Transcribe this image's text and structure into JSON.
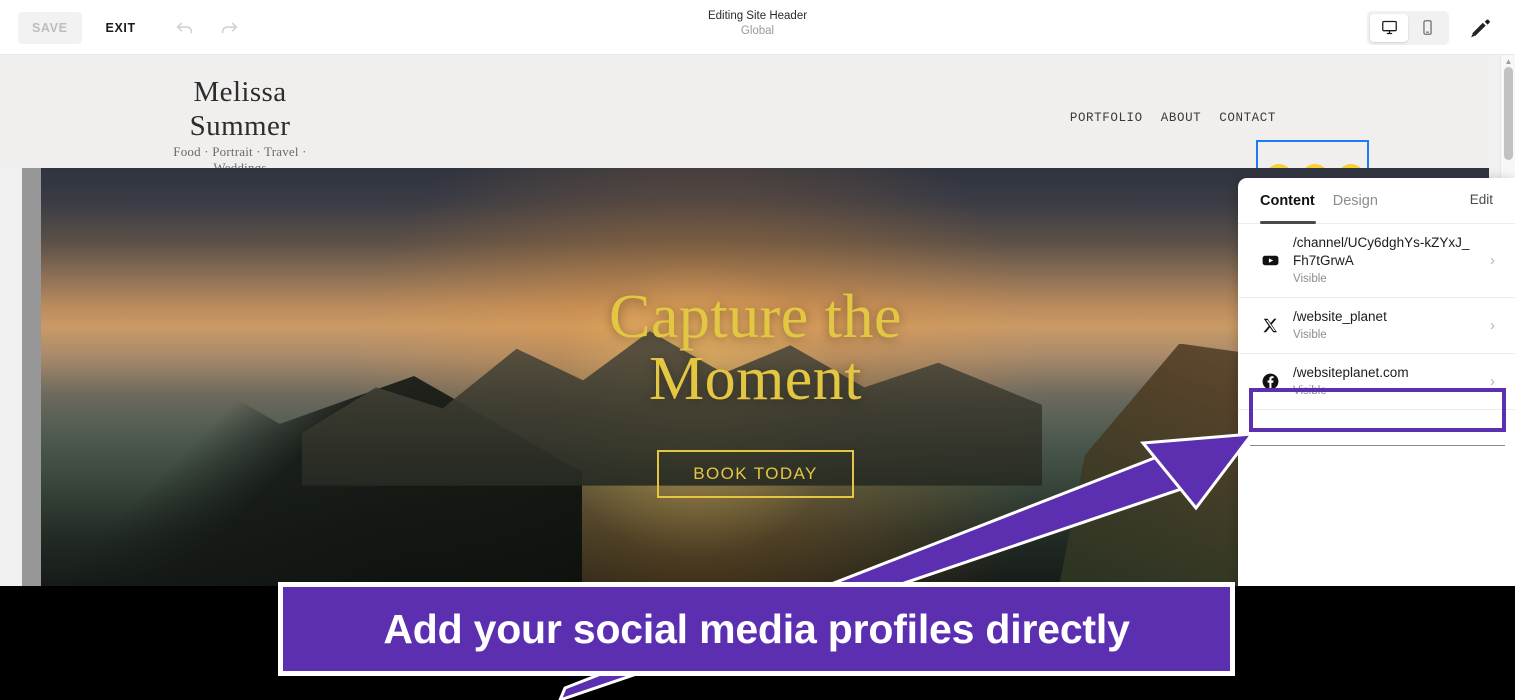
{
  "toolbar": {
    "save_label": "SAVE",
    "exit_label": "EXIT",
    "undo_icon": "undo-arrow-icon",
    "redo_icon": "redo-arrow-icon",
    "title": "Editing Site Header",
    "subtitle": "Global",
    "desktop_icon": "desktop-monitor-icon",
    "mobile_icon": "mobile-phone-icon",
    "brush_icon": "paintbrush-icon",
    "active_device": "desktop"
  },
  "site": {
    "logo_name": "Melissa Summer",
    "logo_tagline": "Food · Portrait · Travel · Weddings",
    "nav": [
      {
        "label": "PORTFOLIO"
      },
      {
        "label": "ABOUT"
      },
      {
        "label": "CONTACT"
      }
    ],
    "social_icons": [
      {
        "name": "youtube-icon",
        "glyph": "youtube"
      },
      {
        "name": "x-twitter-icon",
        "glyph": "x"
      },
      {
        "name": "facebook-icon",
        "glyph": "facebook"
      }
    ],
    "social_chip_color": "#f9cf33",
    "selection_color": "#1f7bf4",
    "hero_line1": "Capture the",
    "hero_line2": "Moment",
    "hero_button": "BOOK TODAY",
    "hero_accent_color": "#e3c742"
  },
  "panel": {
    "tabs": [
      {
        "label": "Content",
        "active": true
      },
      {
        "label": "Design",
        "active": false
      }
    ],
    "edit_label": "Edit",
    "items": [
      {
        "icon": "youtube-icon",
        "title": "/channel/UCy6dghYs-kZYxJ_Fh7tGrwA",
        "status": "Visible",
        "chevron": "chevron-right-icon"
      },
      {
        "icon": "x-twitter-icon",
        "title": "/website_planet",
        "status": "Visible",
        "chevron": "chevron-right-icon"
      },
      {
        "icon": "facebook-icon",
        "title": "/websiteplanet.com",
        "status": "Visible",
        "chevron": "chevron-right-icon"
      }
    ]
  },
  "annotation": {
    "caption": "Add your social media profiles directly",
    "highlight_color": "#5b2fb0",
    "arrow_name": "annotation-arrow"
  }
}
